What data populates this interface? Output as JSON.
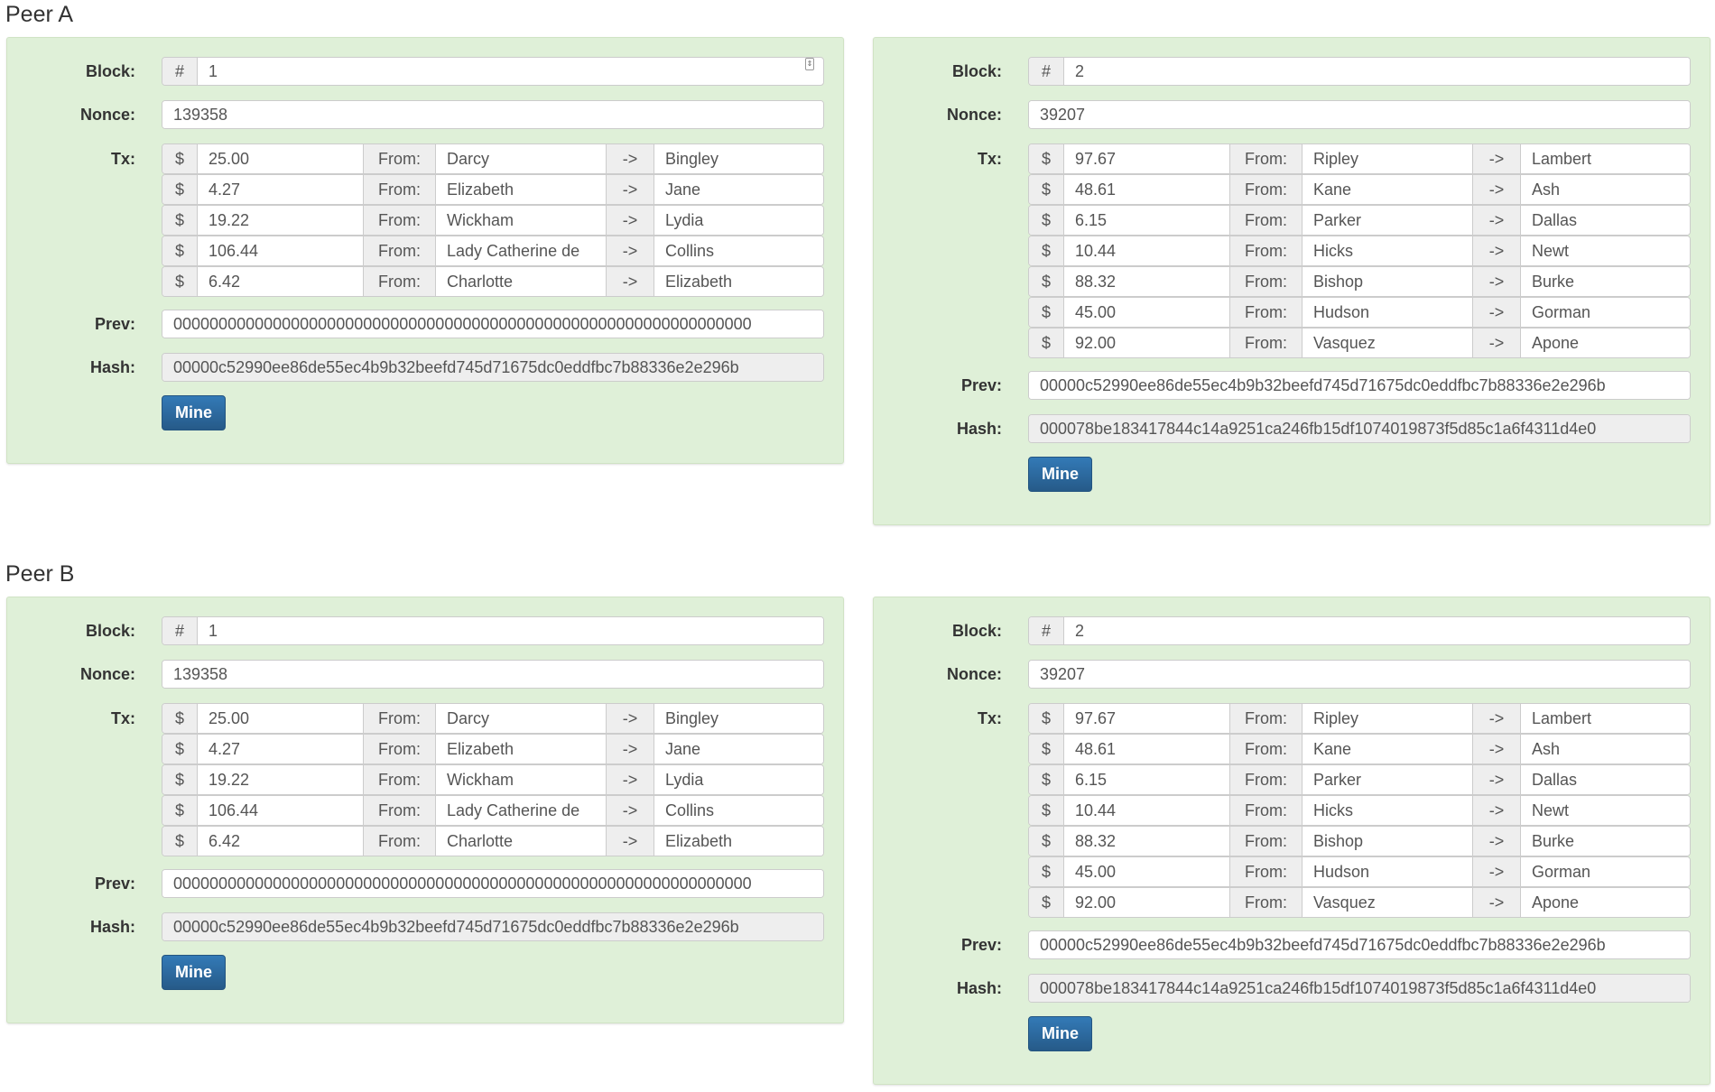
{
  "labels": {
    "block": "Block:",
    "nonce": "Nonce:",
    "tx": "Tx:",
    "prev": "Prev:",
    "hash": "Hash:",
    "hash_sign": "#",
    "dollar": "$",
    "from": "From:",
    "arrow": "->",
    "mine": "Mine"
  },
  "peers": [
    {
      "name": "Peer A",
      "blocks": [
        {
          "block": "1",
          "nonce": "139358",
          "txs": [
            [
              "25.00",
              "Darcy",
              "Bingley"
            ],
            [
              "4.27",
              "Elizabeth",
              "Jane"
            ],
            [
              "19.22",
              "Wickham",
              "Lydia"
            ],
            [
              "106.44",
              "Lady Catherine de",
              "Collins"
            ],
            [
              "6.42",
              "Charlotte",
              "Elizabeth"
            ]
          ],
          "prev": "0000000000000000000000000000000000000000000000000000000000000000",
          "hash": "00000c52990ee86de55ec4b9b32beefd745d71675dc0eddfbc7b88336e2e296b"
        },
        {
          "block": "2",
          "nonce": "39207",
          "txs": [
            [
              "97.67",
              "Ripley",
              "Lambert"
            ],
            [
              "48.61",
              "Kane",
              "Ash"
            ],
            [
              "6.15",
              "Parker",
              "Dallas"
            ],
            [
              "10.44",
              "Hicks",
              "Newt"
            ],
            [
              "88.32",
              "Bishop",
              "Burke"
            ],
            [
              "45.00",
              "Hudson",
              "Gorman"
            ],
            [
              "92.00",
              "Vasquez",
              "Apone"
            ]
          ],
          "prev": "00000c52990ee86de55ec4b9b32beefd745d71675dc0eddfbc7b88336e2e296b",
          "hash": "000078be183417844c14a9251ca246fb15df1074019873f5d85c1a6f4311d4e0"
        }
      ]
    },
    {
      "name": "Peer B",
      "blocks": [
        {
          "block": "1",
          "nonce": "139358",
          "txs": [
            [
              "25.00",
              "Darcy",
              "Bingley"
            ],
            [
              "4.27",
              "Elizabeth",
              "Jane"
            ],
            [
              "19.22",
              "Wickham",
              "Lydia"
            ],
            [
              "106.44",
              "Lady Catherine de",
              "Collins"
            ],
            [
              "6.42",
              "Charlotte",
              "Elizabeth"
            ]
          ],
          "prev": "0000000000000000000000000000000000000000000000000000000000000000",
          "hash": "00000c52990ee86de55ec4b9b32beefd745d71675dc0eddfbc7b88336e2e296b"
        },
        {
          "block": "2",
          "nonce": "39207",
          "txs": [
            [
              "97.67",
              "Ripley",
              "Lambert"
            ],
            [
              "48.61",
              "Kane",
              "Ash"
            ],
            [
              "6.15",
              "Parker",
              "Dallas"
            ],
            [
              "10.44",
              "Hicks",
              "Newt"
            ],
            [
              "88.32",
              "Bishop",
              "Burke"
            ],
            [
              "45.00",
              "Hudson",
              "Gorman"
            ],
            [
              "92.00",
              "Vasquez",
              "Apone"
            ]
          ],
          "prev": "00000c52990ee86de55ec4b9b32beefd745d71675dc0eddfbc7b88336e2e296b",
          "hash": "000078be183417844c14a9251ca246fb15df1074019873f5d85c1a6f4311d4e0"
        }
      ]
    }
  ]
}
